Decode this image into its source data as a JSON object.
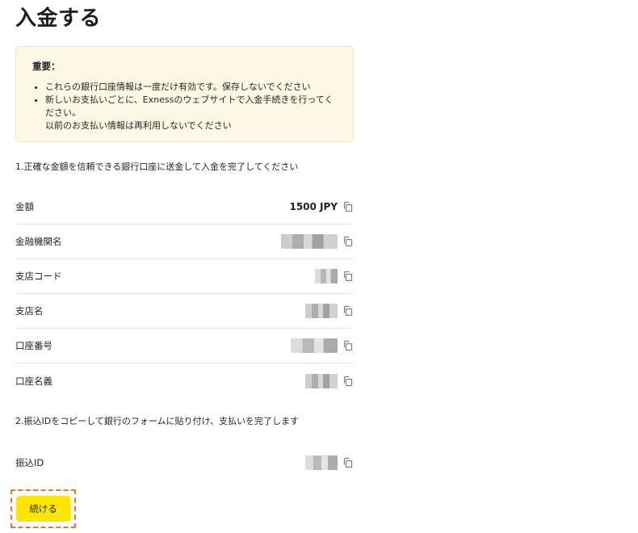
{
  "page": {
    "title": "入金する"
  },
  "notice": {
    "title": "重要：",
    "items": [
      "これらの銀行口座情報は一度だけ有効です。保存しないでください",
      "新しいお支払いごとに、Exnessのウェブサイトで入金手続きを行ってください。",
      "以前のお支払い情報は再利用しないでください"
    ]
  },
  "step1": {
    "text": "1.正確な金額を信頼できる銀行口座に送金して入金を完了してください"
  },
  "bank_details": [
    {
      "label": "金額",
      "value": "1500 JPY",
      "redacted": false
    },
    {
      "label": "金融機関名",
      "value": "",
      "redacted": true
    },
    {
      "label": "支店コード",
      "value": "",
      "redacted": true
    },
    {
      "label": "支店名",
      "value": "",
      "redacted": true
    },
    {
      "label": "口座番号",
      "value": "",
      "redacted": true
    },
    {
      "label": "口座名義",
      "value": "",
      "redacted": true
    }
  ],
  "step2": {
    "text": "2.振込IDをコピーして銀行のフォームに貼り付け、支払いを完了します"
  },
  "transfer": {
    "label": "振込ID",
    "value": "",
    "redacted": true
  },
  "actions": {
    "continue_label": "続ける"
  },
  "icons": {
    "copy": "copy-icon"
  },
  "colors": {
    "accent": "#ffe600",
    "notice_bg": "#fdf8e4",
    "highlight": "#e0782a"
  }
}
